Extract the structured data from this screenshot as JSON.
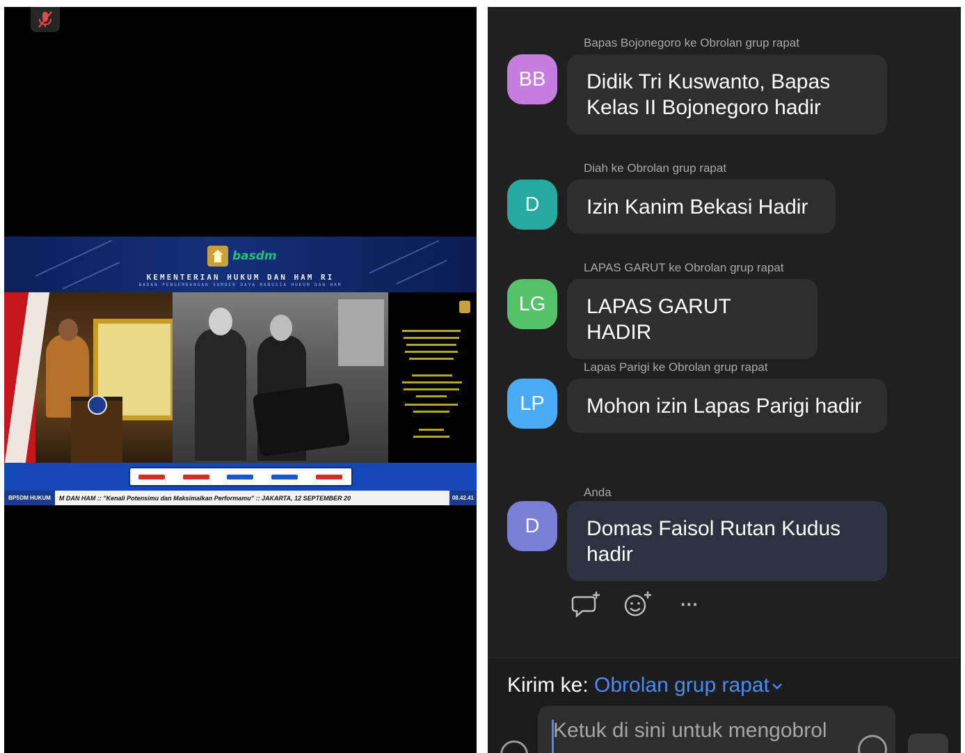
{
  "video": {
    "mic_status_icon": "mic-muted-icon",
    "banner": {
      "logo_text": "basdm",
      "ministry": "KEMENTERIAN HUKUM DAN HAM RI",
      "agency": "BADAN PENGEMBANGAN SUMBER DAYA MANUSIA HUKUM DAN HAM"
    },
    "ticker": {
      "brand": "BPSDM HUKUM",
      "text": "M DAN HAM  ::  \"Kenali Potensimu dan Maksimalkan Performamu\"  ::  JAKARTA, 12 SEPTEMBER 20",
      "clock": "08.42.41"
    }
  },
  "chat": {
    "messages": [
      {
        "sender": "Bapas Bojonegoro ke Obrolan grup rapat",
        "initials": "BB",
        "avatar_color": "#c77ddf",
        "text": "Didik Tri Kuswanto, Bapas Kelas II Bojonegoro hadir"
      },
      {
        "sender": "Diah ke Obrolan grup rapat",
        "initials": "D",
        "avatar_color": "#27a9a0",
        "text": "Izin Kanim Bekasi Hadir"
      },
      {
        "sender": "LAPAS GARUT ke Obrolan grup rapat",
        "initials": "LG",
        "avatar_color": "#56c26a",
        "text": "LAPAS GARUT HADIR"
      },
      {
        "sender": "Lapas Parigi ke Obrolan grup rapat",
        "initials": "LP",
        "avatar_color": "#4aaaf2",
        "text": "Mohon izin Lapas Parigi hadir"
      },
      {
        "sender": "Anda",
        "initials": "D",
        "avatar_color": "#7a7fd6",
        "text": "Domas Faisol Rutan Kudus hadir"
      }
    ],
    "actions": {
      "more_label": "···"
    },
    "composer": {
      "send_to_label": "Kirim ke:",
      "send_to_target": "Obrolan grup rapat",
      "placeholder": "Ketuk di sini untuk mengobrol"
    }
  }
}
